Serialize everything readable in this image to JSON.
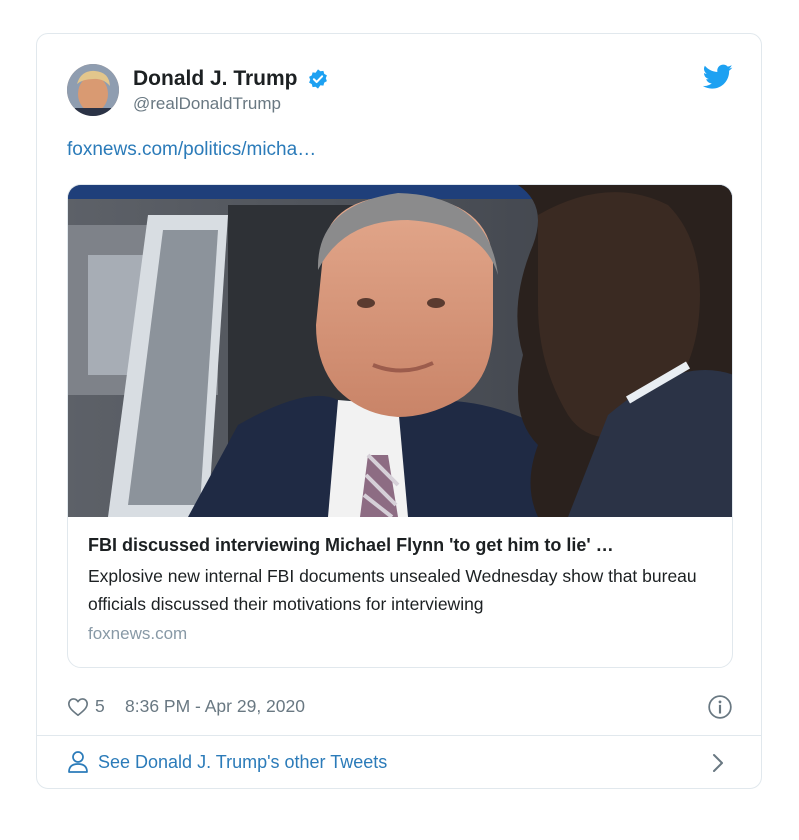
{
  "tweet": {
    "display_name": "Donald J. Trump",
    "handle": "@realDonaldTrump",
    "verified": true,
    "link_text": "foxnews.com/politics/micha…",
    "card": {
      "title": "FBI discussed interviewing Michael Flynn 'to get him to lie' …",
      "description": "Explosive new internal FBI documents unsealed Wednesday show that bureau officials discussed their motivations for interviewing",
      "domain": "foxnews.com"
    },
    "likes": "5",
    "timestamp": "8:36 PM - Apr 29, 2020"
  },
  "footer": {
    "other_tweets_label": "See Donald J. Trump's other Tweets"
  },
  "colors": {
    "link": "#2b7bb9",
    "verified": "#1da1f2",
    "muted": "#697882",
    "border": "#e1e8ed"
  },
  "icons": [
    "verified-badge-icon",
    "twitter-bird-icon",
    "heart-icon",
    "info-icon",
    "person-icon",
    "chevron-right-icon"
  ]
}
